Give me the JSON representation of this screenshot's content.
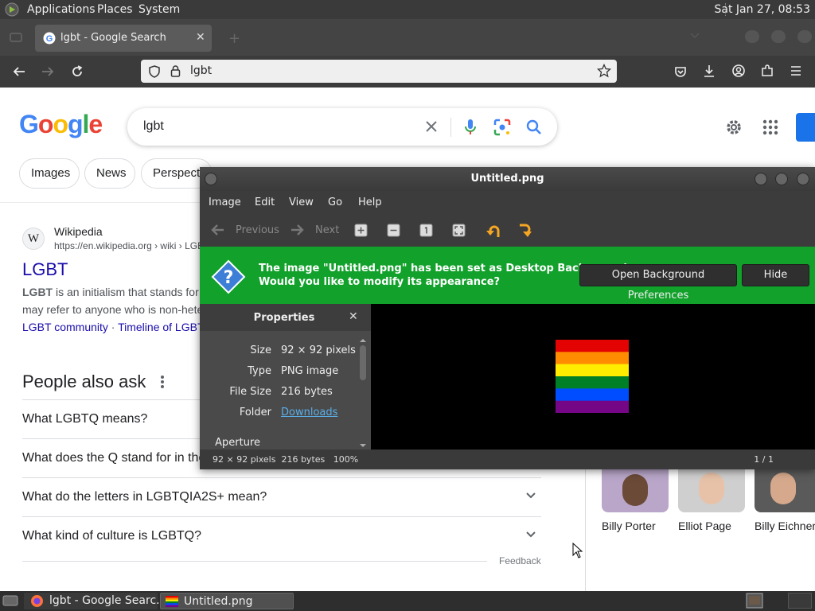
{
  "panel": {
    "menus": [
      "Applications",
      "Places",
      "System"
    ],
    "clock": "Sat Jan 27, 08:53"
  },
  "browser": {
    "tab_title": "lgbt - Google Search",
    "url_text": "lgbt"
  },
  "google": {
    "logo": "Google",
    "query": "lgbt",
    "chips": [
      "Images",
      "News",
      "Perspecti"
    ],
    "result": {
      "source_name": "Wikipedia",
      "source_url": "https://en.wikipedia.org › wiki › LGB",
      "title": "LGBT",
      "snippet_bold": "LGBT",
      "snippet_line1": " is an initialism that stands for",
      "snippet_line2": "may refer to anyone who is non-hete",
      "link1": "LGBT community",
      "sep": "·",
      "link2": "Timeline of LGBT"
    },
    "paa": {
      "heading": "People also ask",
      "questions": [
        "What LGBTQ means?",
        "What does the Q stand for in the",
        "What do the letters in LGBTQIA2S+ mean?",
        "What kind of culture is LGBTQ?"
      ],
      "feedback": "Feedback"
    },
    "people": [
      "Billy Porter",
      "Elliot Page",
      "Billy Eichner"
    ]
  },
  "viewer": {
    "title": "Untitled.png",
    "menus": [
      "Image",
      "Edit",
      "View",
      "Go",
      "Help"
    ],
    "previous": "Previous",
    "next": "Next",
    "info_line1": "The image \"Untitled.png\" has been set as Desktop Background.",
    "info_line2": "Would you like to modify its appearance?",
    "open_prefs": "Open Background Preferences",
    "hide": "Hide",
    "properties_title": "Properties",
    "props": [
      {
        "key": "Size",
        "value": "92 × 92 pixels"
      },
      {
        "key": "Type",
        "value": "PNG image"
      },
      {
        "key": "File Size",
        "value": "216 bytes"
      },
      {
        "key": "Folder",
        "value": "Downloads"
      }
    ],
    "aperture": "Aperture",
    "status_left": "92 × 92 pixels  216 bytes   100%",
    "status_right": "1 / 1",
    "flag_colors": [
      "#e40303",
      "#ff8c00",
      "#ffed00",
      "#008026",
      "#004dff",
      "#750787"
    ]
  },
  "taskbar": {
    "items": [
      "lgbt - Google Searc...",
      "Untitled.png"
    ]
  },
  "colors": {
    "link": "#1a0dab",
    "info_green": "#12a12b"
  }
}
